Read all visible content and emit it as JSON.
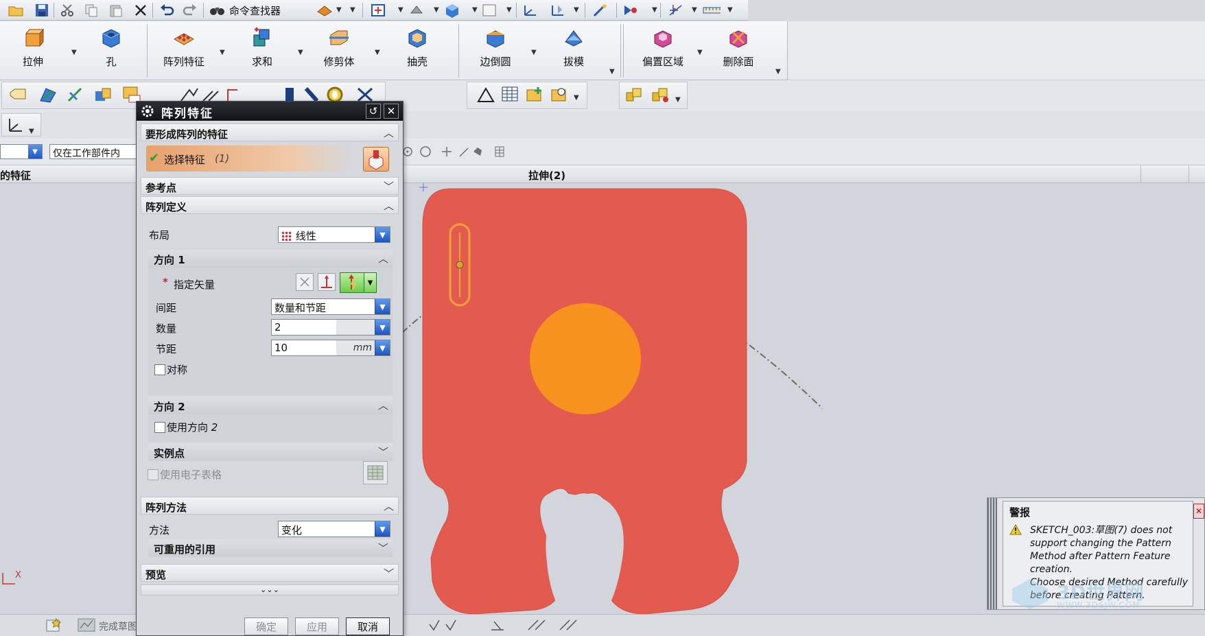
{
  "quick_access": {
    "command_finder_label": "命令查找器"
  },
  "ribbon": {
    "buttons": [
      {
        "label": "拉伸",
        "icon": "extrude-icon"
      },
      {
        "label": "孔",
        "icon": "hole-icon"
      },
      {
        "label": "阵列特征",
        "icon": "pattern-feature-icon"
      },
      {
        "label": "求和",
        "icon": "unite-icon"
      },
      {
        "label": "修剪体",
        "icon": "trim-body-icon"
      },
      {
        "label": "抽壳",
        "icon": "shell-icon"
      },
      {
        "label": "边倒圆",
        "icon": "edge-blend-icon"
      },
      {
        "label": "拔模",
        "icon": "draft-icon"
      },
      {
        "label": "偏置区域",
        "icon": "offset-region-icon"
      },
      {
        "label": "删除面",
        "icon": "delete-face-icon"
      }
    ]
  },
  "selection_bar": {
    "filter_value": "",
    "scope_value": "仅在工作部件内"
  },
  "column_header": {
    "left": "的特征",
    "right": "拉伸(2)"
  },
  "dialog": {
    "title": "阵列特征",
    "section_features": "要形成阵列的特征",
    "select_feature_label": "选择特征",
    "select_feature_count": "(1)",
    "section_reference_point": "参考点",
    "section_pattern_definition": "阵列定义",
    "layout_label": "布局",
    "layout_value": "线性",
    "direction1_title": "方向 1",
    "specify_vector_label": "指定矢量",
    "required_marker": "*",
    "spacing_label": "间距",
    "spacing_value": "数量和节距",
    "count_label": "数量",
    "count_value": "2",
    "pitch_label": "节距",
    "pitch_value": "10",
    "pitch_unit": "mm",
    "symmetric_label": "对称",
    "direction2_title": "方向 2",
    "use_direction2_label": "使用方向",
    "use_direction2_num": "2",
    "instance_points_title": "实例点",
    "use_spreadsheet_label": "使用电子表格",
    "section_pattern_method": "阵列方法",
    "method_label": "方法",
    "method_value": "变化",
    "reusable_refs_title": "可重用的引用",
    "section_preview": "预览",
    "ok_label": "确定",
    "apply_label": "应用",
    "cancel_label": "取消"
  },
  "alert": {
    "title": "警报",
    "message_1": "SKETCH_003:草图(7) does not support changing the Pattern Method after Pattern Feature creation.",
    "message_2": "Choose desired Method carefully before creating Pattern."
  },
  "status": {
    "finish_sketch_label": "完成草图"
  },
  "axis": {
    "x_label": "X"
  },
  "watermark": {
    "text": "3D世界网",
    "url": "WWW.3DSJW.COM"
  },
  "colors": {
    "part_fill": "#e35a4f",
    "hole_fill": "#f7921e",
    "slot_outline": "#f0a13a",
    "selected_gradient_start": "#e7a16b",
    "accent_blue": "#1d57c2"
  }
}
